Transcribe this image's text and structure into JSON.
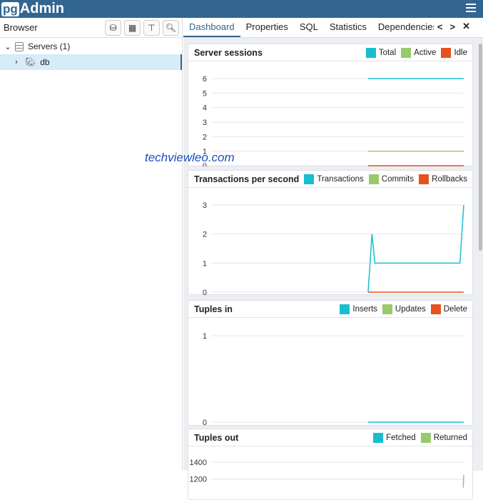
{
  "app": {
    "logo_pg": "pg",
    "logo_admin": "Admin"
  },
  "browser": {
    "title": "Browser",
    "tree": [
      {
        "label": "Servers (1)"
      },
      {
        "label": "db"
      }
    ]
  },
  "tabs": [
    "Dashboard",
    "Properties",
    "SQL",
    "Statistics",
    "Dependencies"
  ],
  "watermark": "techviewleo.com",
  "colors": {
    "teal": "#17becf",
    "green": "#98ca69",
    "red": "#e8501e",
    "accent": "#326690"
  },
  "chart_data": [
    {
      "type": "line",
      "title": "Server sessions",
      "yticks": [
        0,
        1,
        2,
        3,
        4,
        5,
        6
      ],
      "ylim": [
        0,
        6
      ],
      "series": [
        {
          "name": "Total",
          "color": "#17becf",
          "x": [
            0,
            1
          ],
          "y": [
            6,
            6
          ]
        },
        {
          "name": "Active",
          "color": "#98ca69",
          "x": [
            0,
            1
          ],
          "y": [
            1,
            1
          ]
        },
        {
          "name": "Idle",
          "color": "#e8501e",
          "x": [
            0,
            1
          ],
          "y": [
            0,
            0
          ]
        }
      ]
    },
    {
      "type": "line",
      "title": "Transactions per second",
      "yticks": [
        0,
        1,
        2,
        3
      ],
      "ylim": [
        0,
        3
      ],
      "series": [
        {
          "name": "Transactions",
          "color": "#17becf",
          "x": [
            0,
            0.04,
            0.07,
            0.96,
            1
          ],
          "y": [
            0,
            2,
            1,
            1,
            3
          ]
        },
        {
          "name": "Commits",
          "color": "#98ca69",
          "x": [],
          "y": []
        },
        {
          "name": "Rollbacks",
          "color": "#e8501e",
          "x": [
            0,
            1
          ],
          "y": [
            0,
            0
          ]
        }
      ]
    },
    {
      "type": "line",
      "title": "Tuples in",
      "yticks": [
        0,
        1
      ],
      "ylim": [
        0,
        1
      ],
      "series": [
        {
          "name": "Inserts",
          "color": "#17becf",
          "x": [
            0,
            1
          ],
          "y": [
            0,
            0
          ]
        },
        {
          "name": "Updates",
          "color": "#98ca69",
          "x": [],
          "y": []
        },
        {
          "name": "Delete",
          "color": "#e8501e",
          "x": [],
          "y": []
        }
      ]
    },
    {
      "type": "line",
      "title": "Tuples out",
      "yticks": [
        1200,
        1400
      ],
      "ylim": [
        0,
        1400
      ],
      "series": [
        {
          "name": "Fetched",
          "color": "#17becf",
          "x": [],
          "y": []
        },
        {
          "name": "Returned",
          "color": "#98ca69",
          "x": [
            0.995,
            1
          ],
          "y": [
            1100,
            1250
          ]
        }
      ]
    }
  ]
}
